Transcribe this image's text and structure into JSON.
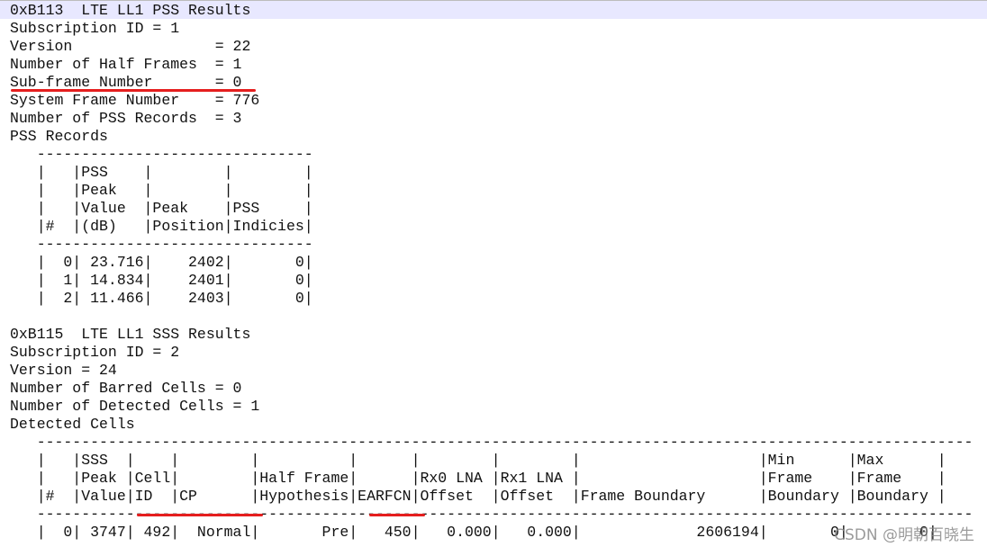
{
  "pss": {
    "header": "0xB113  LTE LL1 PSS Results",
    "fields": [
      "Subscription ID = 1",
      "Version                = 22",
      "Number of Half Frames  = 1",
      "Sub-frame Number       = 0",
      "System Frame Number    = 776",
      "Number of PSS Records  = 3",
      "PSS Records"
    ],
    "table": [
      "   -------------------------------",
      "   |   |PSS    |        |        |",
      "   |   |Peak   |        |        |",
      "   |   |Value  |Peak    |PSS     |",
      "   |#  |(dB)   |Position|Indicies|",
      "   -------------------------------",
      "   |  0| 23.716|    2402|       0|",
      "   |  1| 14.834|    2401|       0|",
      "   |  2| 11.466|    2403|       0|"
    ]
  },
  "sss": {
    "header": "0xB115  LTE LL1 SSS Results",
    "fields": [
      "Subscription ID = 2",
      "Version = 24",
      "Number of Barred Cells = 0",
      "Number of Detected Cells = 1",
      "Detected Cells"
    ],
    "table": [
      "   ---------------------------------------------------------------------------------------------------------",
      "   |   |SSS  |    |        |          |      |        |        |                    |Min      |Max      |",
      "   |   |Peak |Cell|        |Half Frame|      |Rx0 LNA |Rx1 LNA |                    |Frame    |Frame    |",
      "   |#  |Value|ID  |CP      |Hypothesis|EARFCN|Offset  |Offset  |Frame Boundary      |Boundary |Boundary |",
      "   ---------------------------------------------------------------------------------------------------------",
      "   |  0| 3747| 492|  Normal|       Pre|   450|   0.000|   0.000|             2606194|       0|        0|"
    ]
  },
  "watermark": "CSDN @明朝百晓生",
  "colors": {
    "highlight_line": "#e8e8ff",
    "underline_mark": "#e51e1e",
    "text": "#111111"
  }
}
